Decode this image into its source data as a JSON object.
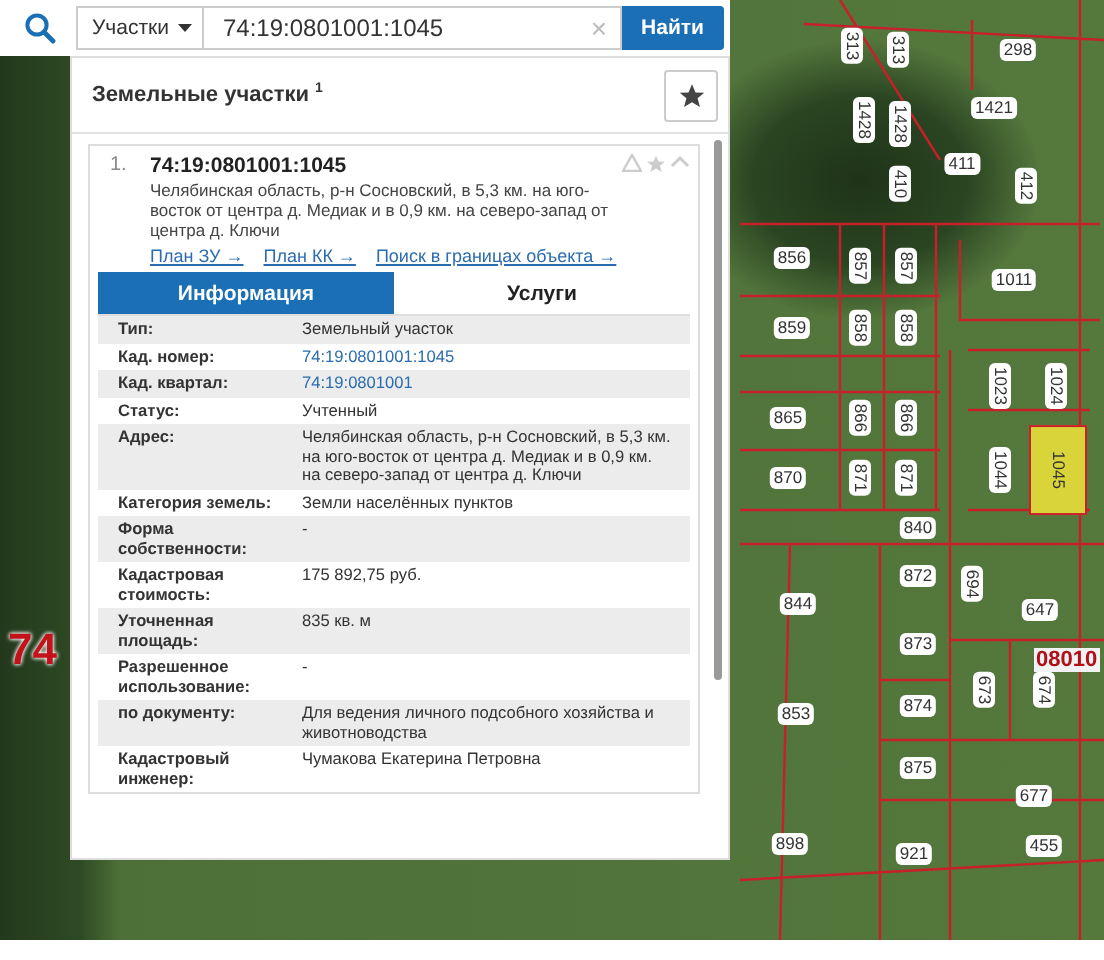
{
  "search": {
    "scope": "Участки",
    "query": "74:19:0801001:1045",
    "clear": "×",
    "button": "Найти"
  },
  "results_panel": {
    "title": "Земельные участки $^{1}$",
    "result": {
      "number": "1.",
      "cadastral_number": "74:19:0801001:1045",
      "address": "Челябинская область, р-н Сосновский, в 5,3 км. на юго-восток от центра д. Медиак и в 0,9 км. на северо-запад от центра д. Ключи",
      "links": [
        "План ЗУ →",
        "План КК →",
        "Поиск в границах объекта →"
      ],
      "tabs": [
        {
          "label": "Информация",
          "selected": true
        },
        {
          "label": "Услуги",
          "selected": false
        }
      ],
      "fields": [
        {
          "label": "Тип:",
          "value": "Земельный участок",
          "kind": "text"
        },
        {
          "label": "Кад. номер:",
          "value": "74:19:0801001:1045",
          "kind": "link"
        },
        {
          "label": "Кад. квартал:",
          "value": "74:19:0801001",
          "kind": "link"
        },
        {
          "label": "Статус:",
          "value": "Учтенный",
          "kind": "text"
        },
        {
          "label": "Адрес:",
          "value": "Челябинская область, р-н Сосновский, в 5,3 км. на юго-восток от центра д. Медиак и в 0,9 км. на северо-запад от центра д. Ключи",
          "kind": "text"
        },
        {
          "label": "Категория земель:",
          "value": "Земли населённых пунктов",
          "kind": "text"
        },
        {
          "label": "Форма собственности:",
          "value": "-",
          "kind": "text"
        },
        {
          "label": "Кадастровая стоимость:",
          "value": "175 892,75 руб.",
          "kind": "text"
        },
        {
          "label": "Уточненная площадь:",
          "value": "835 кв. м",
          "kind": "text"
        },
        {
          "label": "Разрешенное использование:",
          "value": "-",
          "kind": "text"
        },
        {
          "label": "по документу:",
          "value": "Для ведения личного подсобного хозяйства и животноводства",
          "kind": "text"
        },
        {
          "label": "Кадастровый инженер:",
          "value": "Чумакова Екатерина Петровна",
          "kind": "text"
        }
      ]
    }
  },
  "map": {
    "area_labels": [
      "74",
      "08010"
    ],
    "parcels": [
      {
        "text": "313",
        "selected": false
      },
      {
        "text": "313",
        "selected": false
      },
      {
        "text": "298",
        "selected": false
      },
      {
        "text": "1421",
        "selected": false
      },
      {
        "text": "1428",
        "selected": false
      },
      {
        "text": "1428",
        "selected": false
      },
      {
        "text": "411",
        "selected": false
      },
      {
        "text": "412",
        "selected": false
      },
      {
        "text": "410",
        "selected": false
      },
      {
        "text": "856",
        "selected": false
      },
      {
        "text": "857",
        "selected": false
      },
      {
        "text": "857",
        "selected": false
      },
      {
        "text": "1011",
        "selected": false
      },
      {
        "text": "859",
        "selected": false
      },
      {
        "text": "858",
        "selected": false
      },
      {
        "text": "858",
        "selected": false
      },
      {
        "text": "1023",
        "selected": false
      },
      {
        "text": "1024",
        "selected": false
      },
      {
        "text": "865",
        "selected": false
      },
      {
        "text": "866",
        "selected": false
      },
      {
        "text": "866",
        "selected": false
      },
      {
        "text": "870",
        "selected": false
      },
      {
        "text": "871",
        "selected": false
      },
      {
        "text": "871",
        "selected": false
      },
      {
        "text": "1044",
        "selected": false
      },
      {
        "text": "1045",
        "selected": true
      },
      {
        "text": "840",
        "selected": false
      },
      {
        "text": "872",
        "selected": false
      },
      {
        "text": "694",
        "selected": false
      },
      {
        "text": "844",
        "selected": false
      },
      {
        "text": "647",
        "selected": false
      },
      {
        "text": "873",
        "selected": false
      },
      {
        "text": "673",
        "selected": false
      },
      {
        "text": "674",
        "selected": false
      },
      {
        "text": "853",
        "selected": false
      },
      {
        "text": "874",
        "selected": false
      },
      {
        "text": "875",
        "selected": false
      },
      {
        "text": "677",
        "selected": false
      },
      {
        "text": "898",
        "selected": false
      },
      {
        "text": "921",
        "selected": false
      },
      {
        "text": "455",
        "selected": false
      }
    ]
  }
}
